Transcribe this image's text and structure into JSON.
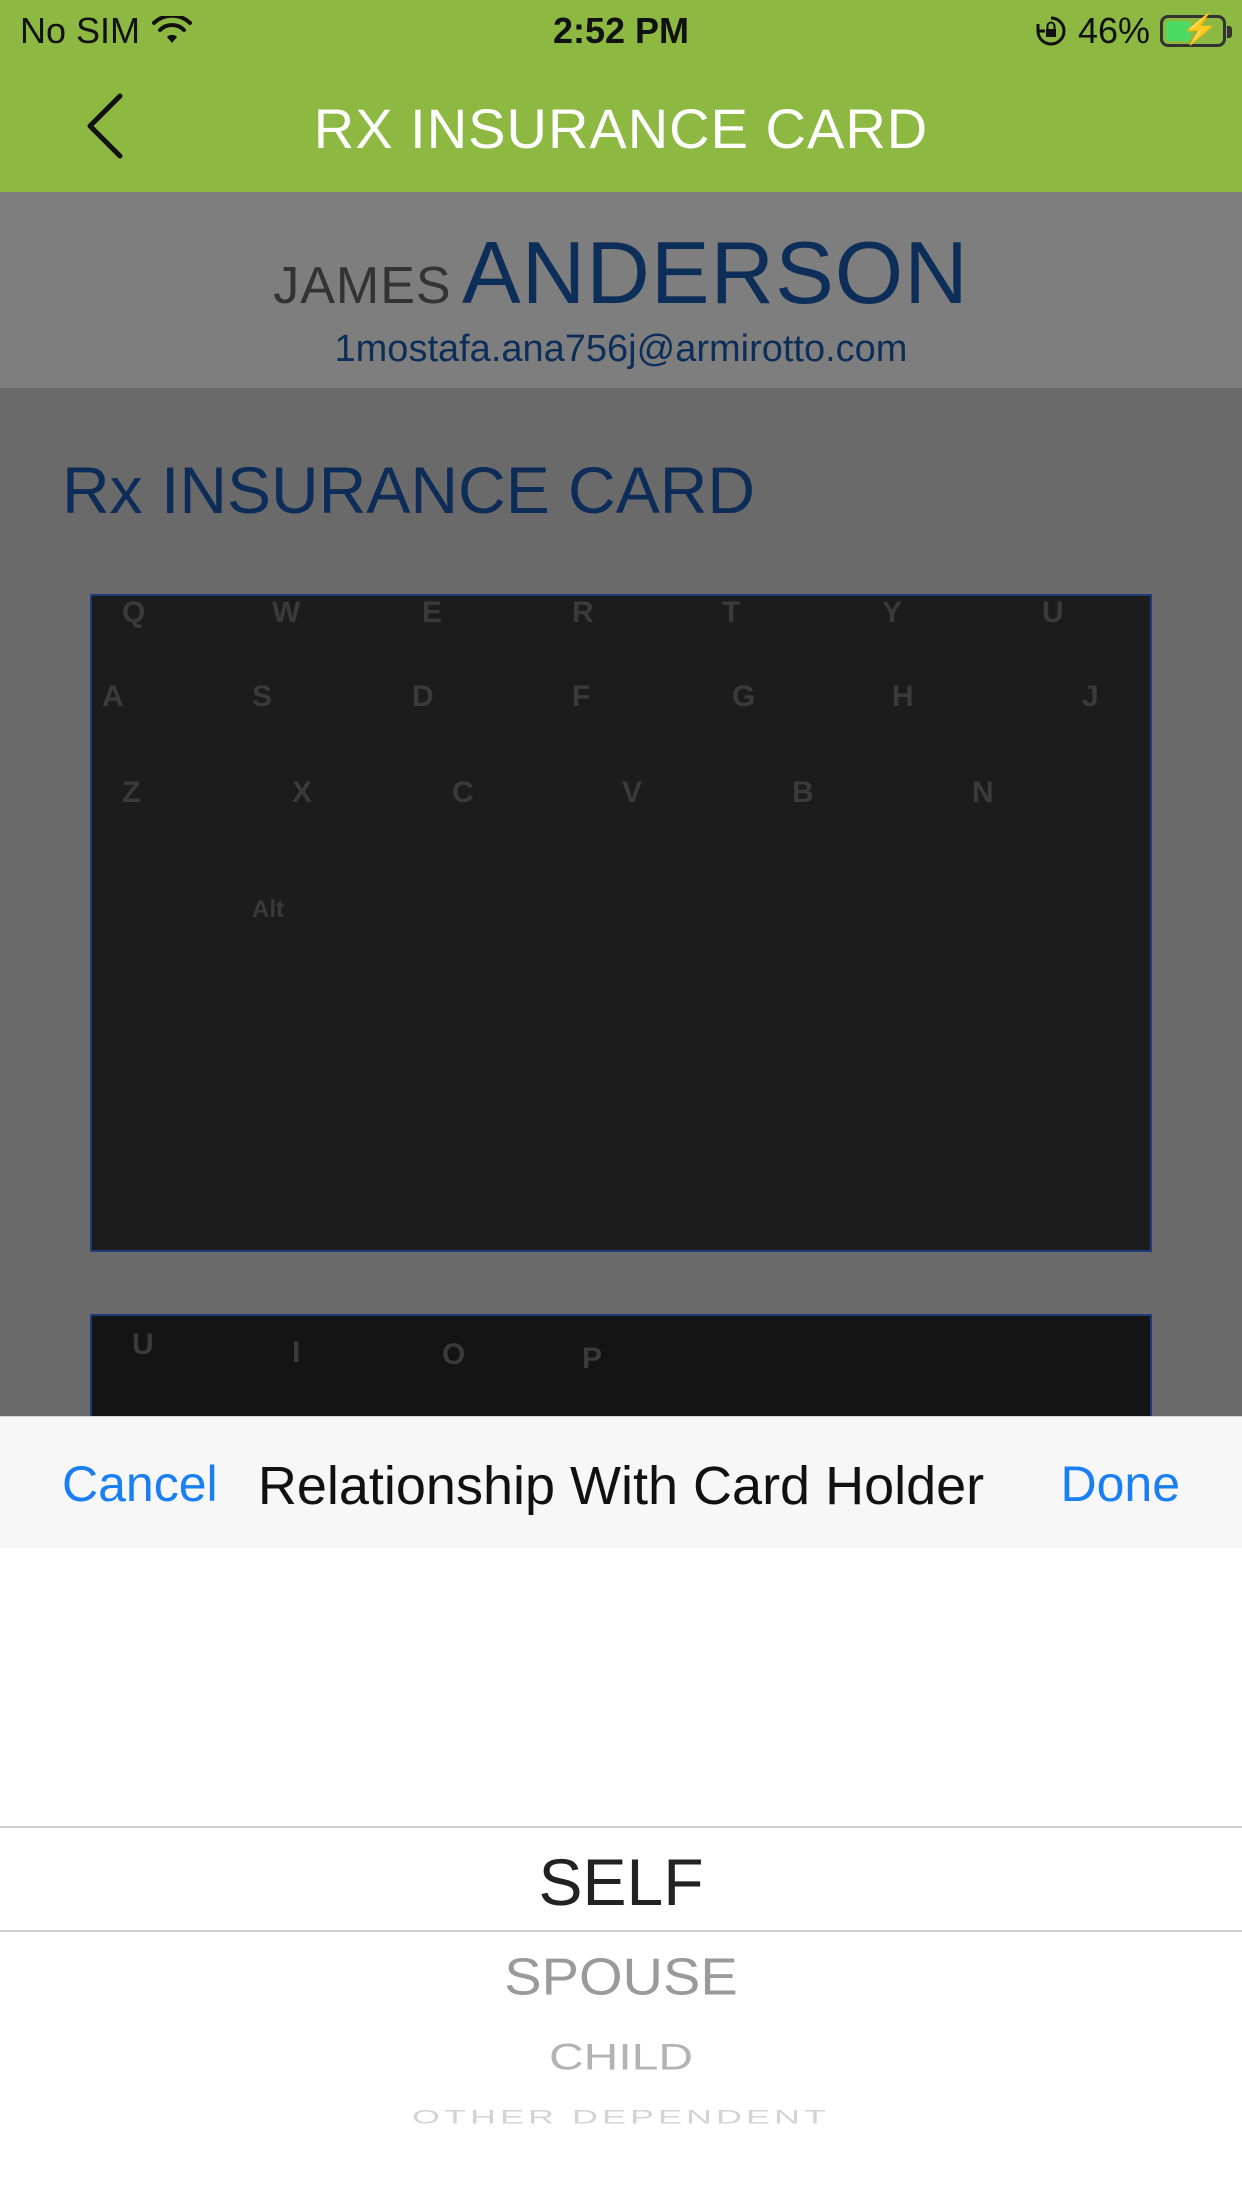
{
  "status_bar": {
    "carrier": "No SIM",
    "time": "2:52 PM",
    "battery": "46%",
    "icons": [
      "wifi-icon",
      "rotation-lock-icon",
      "battery-icon"
    ]
  },
  "nav": {
    "title": "RX INSURANCE CARD",
    "back_icon": "chevron-left-icon"
  },
  "profile": {
    "first_name": "JAMES",
    "last_name": "ANDERSON",
    "email": "1mostafa.ana756j@armirotto.com"
  },
  "content": {
    "section_title": "Rx INSURANCE CARD",
    "image_front_keys": [
      "Q",
      "W",
      "E",
      "R",
      "T",
      "Y",
      "U",
      "A",
      "S",
      "D",
      "F",
      "G",
      "H",
      "J",
      "Z",
      "X",
      "C",
      "V",
      "B",
      "N",
      "Alt"
    ],
    "image_back_keys": [
      "U",
      "I",
      "O",
      "P"
    ]
  },
  "toolbar": {
    "cancel": "Cancel",
    "title": "Relationship With Card Holder",
    "done": "Done"
  },
  "picker": {
    "selected": "SELF",
    "options": [
      "SELF",
      "SPOUSE",
      "CHILD",
      "OTHER DEPENDENT"
    ]
  },
  "colors": {
    "header_green": "#8db842",
    "brand_navy": "#0c2e58",
    "ios_blue": "#1a7ef5"
  }
}
